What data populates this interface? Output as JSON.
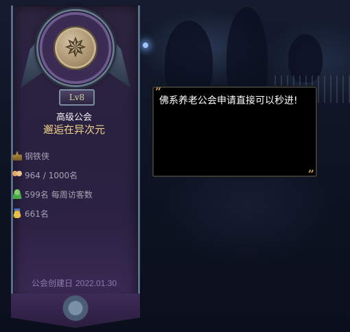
{
  "guild": {
    "level": "Lv8",
    "tier": "高级公会",
    "name": "邂逅在异次元",
    "master": "钢铁侠",
    "members": "964 / 1000名",
    "weekly_visitors": "599名 每周访客数",
    "medals": "661名",
    "founded_label": "公会创建日",
    "founded_date": "2022.01.30"
  },
  "message": {
    "text": "佛系养老公会申请直接可以秒进!"
  },
  "icons": {
    "emblem": "compass-icon",
    "master": "crown-icon",
    "members": "members-icon",
    "visitors": "visitor-icon",
    "medals": "medal-icon"
  },
  "colors": {
    "guild_name": "#f0d28a",
    "founded": "#8f79b0",
    "quote": "#c9a45a"
  }
}
